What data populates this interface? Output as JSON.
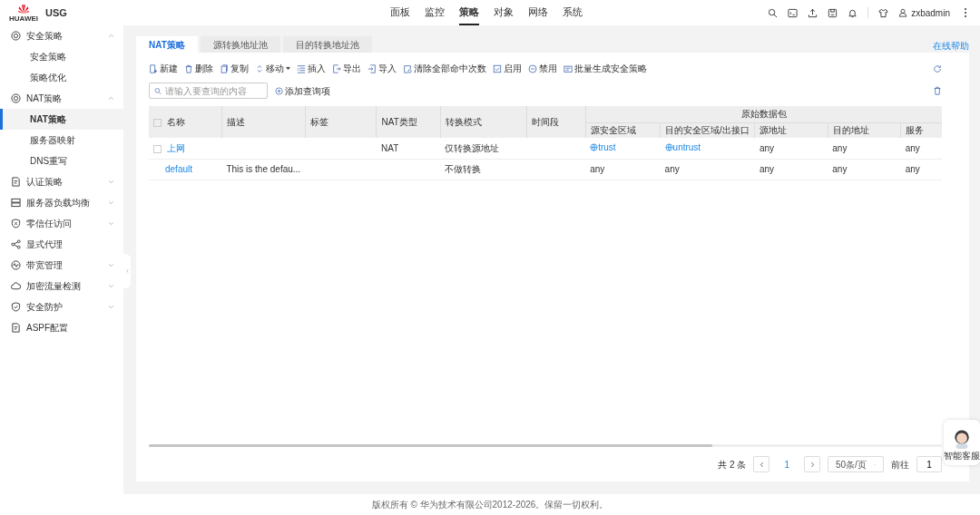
{
  "header": {
    "logo_caption": "HUAWEI",
    "product": "USG",
    "nav": [
      {
        "label": "面板",
        "selected": false
      },
      {
        "label": "监控",
        "selected": false
      },
      {
        "label": "策略",
        "selected": true
      },
      {
        "label": "对象",
        "selected": false
      },
      {
        "label": "网络",
        "selected": false
      },
      {
        "label": "系统",
        "selected": false
      }
    ],
    "user": "zxbadmin"
  },
  "sidebar": {
    "items": [
      {
        "label": "安全策略",
        "expanded": true,
        "selected": false,
        "children": [
          {
            "label": "安全策略",
            "selected": false
          },
          {
            "label": "策略优化",
            "selected": false
          }
        ]
      },
      {
        "label": "NAT策略",
        "expanded": true,
        "selected": false,
        "children": [
          {
            "label": "NAT策略",
            "selected": true
          },
          {
            "label": "服务器映射",
            "selected": false
          },
          {
            "label": "DNS重写",
            "selected": false
          }
        ]
      },
      {
        "label": "认证策略",
        "expanded": false,
        "selected": false
      },
      {
        "label": "服务器负载均衡",
        "expanded": false,
        "selected": false
      },
      {
        "label": "零信任访问",
        "expanded": false,
        "selected": false
      },
      {
        "label": "显式代理",
        "selected": false
      },
      {
        "label": "带宽管理",
        "expanded": false,
        "selected": false
      },
      {
        "label": "加密流量检测",
        "expanded": false,
        "selected": false
      },
      {
        "label": "安全防护",
        "expanded": false,
        "selected": false
      },
      {
        "label": "ASPF配置",
        "selected": false
      }
    ]
  },
  "tabs": [
    {
      "label": "NAT策略",
      "selected": true
    },
    {
      "label": "源转换地址池",
      "selected": false
    },
    {
      "label": "目的转换地址池",
      "selected": false
    }
  ],
  "help_link": "在线帮助",
  "toolbar": [
    "新建",
    "删除",
    "复制",
    "移动",
    "插入",
    "导出",
    "导入",
    "清除全部命中次数",
    "启用",
    "禁用",
    "批量生成安全策略"
  ],
  "search": {
    "placeholder": "请输入要查询的内容"
  },
  "add_query": "添加查询项",
  "table": {
    "select_all_checked": false,
    "columns": [
      "名称",
      "描述",
      "标签",
      "NAT类型",
      "转换模式",
      "时间段"
    ],
    "group": {
      "label": "原始数据包",
      "columns": [
        "源安全区域",
        "目的安全区域/出接口",
        "源地址",
        "目的地址",
        "服务"
      ]
    },
    "rows": [
      {
        "selectable": true,
        "checked": false,
        "cells": [
          {
            "kind": "link",
            "text": "上网"
          },
          {
            "kind": "empty"
          },
          {
            "kind": "empty"
          },
          {
            "kind": "plain",
            "text": "NAT"
          },
          {
            "kind": "plain",
            "text": "仅转换源地址"
          },
          {
            "kind": "empty"
          },
          {
            "kind": "zone",
            "text": "trust"
          },
          {
            "kind": "zone",
            "text": "untrust"
          },
          {
            "kind": "plain",
            "text": "any"
          },
          {
            "kind": "plain",
            "text": "any"
          },
          {
            "kind": "plain",
            "text": "any"
          }
        ]
      },
      {
        "selectable": false,
        "cells": [
          {
            "kind": "link",
            "text": "default"
          },
          {
            "kind": "plain",
            "text": "This is the defau..."
          },
          {
            "kind": "empty"
          },
          {
            "kind": "empty"
          },
          {
            "kind": "plain",
            "text": "不做转换"
          },
          {
            "kind": "empty"
          },
          {
            "kind": "plain",
            "text": "any"
          },
          {
            "kind": "plain",
            "text": "any"
          },
          {
            "kind": "plain",
            "text": "any"
          },
          {
            "kind": "plain",
            "text": "any"
          },
          {
            "kind": "plain",
            "text": "any"
          }
        ]
      }
    ]
  },
  "pagination": {
    "total": "共 2 条",
    "page": "1",
    "page_size": "50条/页",
    "goto_label": "前往",
    "goto_value": "1"
  },
  "assistant": {
    "label": "智能客服"
  },
  "footer": "版权所有 © 华为技术有限公司2012-2026。保留一切权利。"
}
